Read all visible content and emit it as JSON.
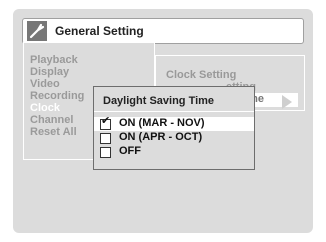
{
  "header": {
    "title": "General Setting",
    "icon": "wrench-icon"
  },
  "main_menu": [
    {
      "label": "Playback",
      "active": false
    },
    {
      "label": "Display",
      "active": false
    },
    {
      "label": "Video",
      "active": false
    },
    {
      "label": "Recording",
      "active": false
    },
    {
      "label": "Clock",
      "active": true
    },
    {
      "label": "Channel",
      "active": false
    },
    {
      "label": "Reset All",
      "active": false
    }
  ],
  "sub_menu": {
    "heading": "Clock Setting",
    "partial_line": "etting",
    "highlighted_label": "ng Time",
    "arrow_icon": "right-arrow-icon"
  },
  "popup": {
    "title": "Daylight Saving Time",
    "options": [
      {
        "label": "ON (MAR - NOV)",
        "checked": true,
        "selected": true
      },
      {
        "label": "ON (APR - OCT)",
        "checked": false,
        "selected": false
      },
      {
        "label": "OFF",
        "checked": false,
        "selected": false
      }
    ]
  },
  "colors": {
    "background": "#dcdcdc",
    "highlight": "#ffffff",
    "text_dim": "#9a9a9a"
  }
}
